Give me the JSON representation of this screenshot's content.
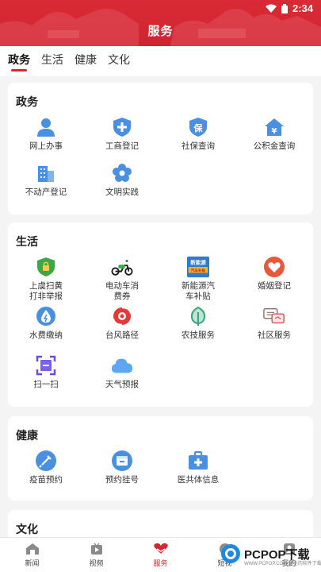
{
  "status_bar": {
    "time": "2:34"
  },
  "header": {
    "title": "服务"
  },
  "tabs": [
    {
      "label": "政务",
      "active": true
    },
    {
      "label": "生活",
      "active": false
    },
    {
      "label": "健康",
      "active": false
    },
    {
      "label": "文化",
      "active": false
    }
  ],
  "sections": {
    "government": {
      "title": "政务",
      "items": [
        {
          "label": "网上办事",
          "icon": "user-icon"
        },
        {
          "label": "工商登记",
          "icon": "shield-plus-icon"
        },
        {
          "label": "社保查询",
          "icon": "shield-bao-icon"
        },
        {
          "label": "公积金查询",
          "icon": "house-yuan-icon"
        },
        {
          "label": "不动产登记",
          "icon": "building-icon"
        },
        {
          "label": "文明实践",
          "icon": "flower-icon"
        }
      ]
    },
    "life": {
      "title": "生活",
      "items": [
        {
          "label": "上虞扫黄\n打非举报",
          "icon": "lock-shield-icon"
        },
        {
          "label": "电动车消\n费券",
          "icon": "scooter-icon"
        },
        {
          "label": "新能源汽\n车补贴",
          "icon": "ev-subsidy-icon",
          "icon_text": "新能源 汽车补贴"
        },
        {
          "label": "婚姻登记",
          "icon": "heart-icon"
        },
        {
          "label": "水费缴纳",
          "icon": "water-drop-icon"
        },
        {
          "label": "台风路径",
          "icon": "typhoon-icon"
        },
        {
          "label": "农技服务",
          "icon": "leaf-icon"
        },
        {
          "label": "社区服务",
          "icon": "chat-icon"
        },
        {
          "label": "扫一扫",
          "icon": "scan-icon"
        },
        {
          "label": "天气预报",
          "icon": "cloud-icon"
        }
      ]
    },
    "health": {
      "title": "健康",
      "items": [
        {
          "label": "疫苗预约",
          "icon": "syringe-icon"
        },
        {
          "label": "预约挂号",
          "icon": "calendar-icon"
        },
        {
          "label": "医共体信息",
          "icon": "medkit-icon"
        }
      ]
    },
    "culture": {
      "title": "文化"
    }
  },
  "bottom_nav": [
    {
      "label": "新闻",
      "icon": "news-icon",
      "active": false
    },
    {
      "label": "视频",
      "icon": "video-icon",
      "active": false
    },
    {
      "label": "服务",
      "icon": "heart-hand-icon",
      "active": true
    },
    {
      "label": "短视",
      "icon": "short-video-icon",
      "active": false
    },
    {
      "label": "我的",
      "icon": "profile-icon",
      "active": false
    }
  ],
  "watermark": {
    "brand": "PCPOP下载",
    "sub": "WWW.PCPOP.COM 最全的软件下载"
  },
  "colors": {
    "brand_red": "#d9252f",
    "blue": "#4a90e2",
    "background": "#f4f4f4"
  }
}
